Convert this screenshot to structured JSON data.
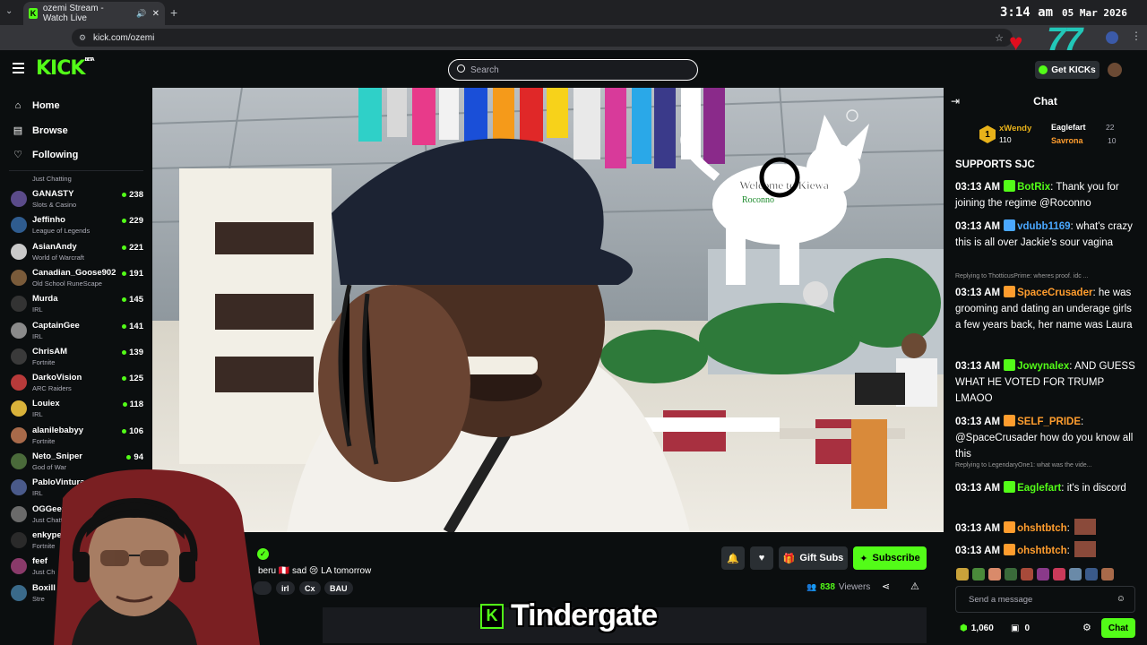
{
  "browser": {
    "tab_title": "ozemi Stream - Watch Live",
    "url": "kick.com/ozemi"
  },
  "overlay": {
    "clock_time": "3:14 am",
    "clock_date": "05 Mar 2026",
    "counter": "77",
    "caption": "Tindergate"
  },
  "header": {
    "logo": "KICK",
    "logo_badge": "BETA",
    "search_placeholder": "Search",
    "get_kicks": "Get KICKs"
  },
  "sidebar": {
    "nav": [
      {
        "label": "Home",
        "icon": "home-icon"
      },
      {
        "label": "Browse",
        "icon": "browse-icon"
      },
      {
        "label": "Following",
        "icon": "heart-icon"
      }
    ],
    "partial_top_game": "Just Chatting",
    "channels": [
      {
        "name": "GANASTY",
        "game": "Slots & Casino",
        "viewers": "238",
        "color": "#5b4b8a"
      },
      {
        "name": "Jeffinho",
        "game": "League of Legends",
        "viewers": "229",
        "color": "#2f5c8f"
      },
      {
        "name": "AsianAndy",
        "game": "World of Warcraft",
        "viewers": "221",
        "color": "#c9c9c9"
      },
      {
        "name": "Canadian_Goose902",
        "game": "Old School RuneScape",
        "viewers": "191",
        "color": "#7a5b3a"
      },
      {
        "name": "Murda",
        "game": "IRL",
        "viewers": "145",
        "color": "#333333"
      },
      {
        "name": "CaptainGee",
        "game": "IRL",
        "viewers": "141",
        "color": "#8a8a8a"
      },
      {
        "name": "ChrisAM",
        "game": "Fortnite",
        "viewers": "139",
        "color": "#3a3a3a"
      },
      {
        "name": "DarkoVision",
        "game": "ARC Raiders",
        "viewers": "125",
        "color": "#b83a3a"
      },
      {
        "name": "Louiex",
        "game": "IRL",
        "viewers": "118",
        "color": "#d9b23a"
      },
      {
        "name": "alanilebabyy",
        "game": "Fortnite",
        "viewers": "106",
        "color": "#a86a4a"
      },
      {
        "name": "Neto_Sniper",
        "game": "God of War",
        "viewers": "94",
        "color": "#4a6a3a"
      },
      {
        "name": "PabloVintura",
        "game": "IRL",
        "viewers": "",
        "color": "#4a5a8a"
      },
      {
        "name": "OGGeezerL",
        "game": "Just Chattin",
        "viewers": "",
        "color": "#6a6a6a"
      },
      {
        "name": "enkypenk",
        "game": "Fortnite",
        "viewers": "",
        "color": "#2a2a2a"
      },
      {
        "name": "feef",
        "game": "Just Ch",
        "viewers": "",
        "color": "#8a3a6a"
      },
      {
        "name": "Boxill",
        "game": "Stre",
        "viewers": "",
        "color": "#3a6a8a"
      }
    ]
  },
  "stream": {
    "video_overlay_text": "Welcome to Kiewa",
    "video_overlay_sub": "Roconno",
    "title_partial": "beru 🇵🇪 sad 😢 LA tomorrow",
    "tags": [
      "irl",
      "Cx",
      "BAU"
    ],
    "viewers": "838",
    "viewers_label": "Viewers",
    "gift_subs": "Gift Subs",
    "subscribe": "Subscribe"
  },
  "chat": {
    "title": "Chat",
    "leaderboard": [
      {
        "rank": "1",
        "name": "xWendy",
        "points": "110"
      },
      {
        "name": "Eaglefart",
        "points": "22"
      },
      {
        "name": "Savrona",
        "points": "10"
      }
    ],
    "partial_top": "SUPPORTS SJC",
    "messages": [
      {
        "time": "03:13 AM",
        "user": "BotRix",
        "color": "#53fc18",
        "text": "Thank you for joining the regime @Roconno"
      },
      {
        "time": "03:13 AM",
        "user": "vdubb1169",
        "color": "#4aa8ff",
        "text": "what's crazy this is all over Jackie's sour vagina"
      },
      {
        "reply": "Replying to ThotticusPrime: wheres proof. idc ..."
      },
      {
        "time": "03:13 AM",
        "user": "SpaceCrusader",
        "color": "#ff9d2e",
        "text": "he was grooming and dating an underage girls a few years back, her name was Laura"
      },
      {
        "time": "03:13 AM",
        "user": "Jowynalex",
        "color": "#53fc18",
        "text": "AND GUESS WHAT HE VOTED FOR TRUMP LMAOO"
      },
      {
        "time": "03:13 AM",
        "user": "SELF_PRIDE",
        "color": "#ff9d2e",
        "text": "@SpaceCrusader how do you know all this"
      },
      {
        "reply": "Replying to LegendaryOne1: what was the vide..."
      },
      {
        "time": "03:13 AM",
        "user": "Eaglefart",
        "color": "#53fc18",
        "text": "it's in discord"
      },
      {
        "time": "03:13 AM",
        "user": "ohshtbtch",
        "color": "#ff9d2e",
        "text": ""
      },
      {
        "time": "03:13 AM",
        "user": "ohshtbtch",
        "color": "#ff9d2e",
        "text": ""
      }
    ],
    "input_placeholder": "Send a message",
    "kicks_count": "1,060",
    "gifts_count": "0",
    "send_button": "Chat"
  }
}
